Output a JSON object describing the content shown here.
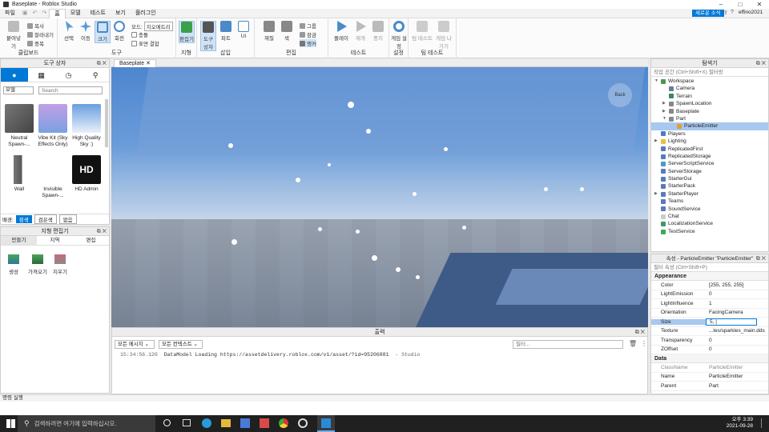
{
  "window": {
    "title": "Baseplate - Roblox Studio"
  },
  "menu": [
    "파일",
    "홈",
    "모델",
    "테스트",
    "보기",
    "플러그인"
  ],
  "user": {
    "share_label": "새로운 소식",
    "username": "effino2021"
  },
  "ribbon": {
    "clipboard": {
      "paste": "붙여넣기",
      "copy": "복사",
      "cut": "잘라내기",
      "duplicate": "중복",
      "label": "클립보드"
    },
    "tools": {
      "select": "선택",
      "move": "이동",
      "scale": "크기",
      "rotate": "회전",
      "mode_label": "모드:",
      "mode_value": "지오메트리",
      "collisions": "충돌",
      "join_surfaces": "표면 결합",
      "label": "도구"
    },
    "terrain": {
      "editor": "편집기",
      "label": "지형"
    },
    "insert": {
      "toolbox": "도구 상자",
      "part": "파트",
      "ui": "UI",
      "label": "삽입"
    },
    "edit": {
      "material": "재질",
      "color": "색",
      "group": "그룹",
      "lock": "잠금",
      "anchor": "앵커",
      "label": "편집"
    },
    "test": {
      "play": "플레이",
      "resume": "재개",
      "stop": "중지",
      "label": "테스트"
    },
    "settings": {
      "game_settings": "게임 설정",
      "label": "설정"
    },
    "team_test": {
      "team_test": "팀 테스트",
      "exit_game": "게임 나가기",
      "label": "팀 테스트"
    }
  },
  "toolbox": {
    "title": "도구 상자",
    "category": "모델",
    "search_placeholder": "Search",
    "items": [
      {
        "label": "Neutral Spawn-...",
        "color": "#555"
      },
      {
        "label": "Vibe Kit (Sky Effects Only)",
        "color": "#b48ad9"
      },
      {
        "label": "High Quality Sky :)",
        "color": "#9ec2ea"
      },
      {
        "label": "Wall",
        "color": "#666"
      },
      {
        "label": "Invisible Spawn-...",
        "color": "#fff"
      },
      {
        "label": "HD Admin",
        "color": "#111"
      }
    ],
    "bg_label": "배경:",
    "bg_options": [
      "흰색",
      "검은색",
      "없음"
    ]
  },
  "terrain_editor": {
    "title": "지형 편집기",
    "tabs": [
      "만들기",
      "지역",
      "편집"
    ],
    "tools": [
      "생성",
      "가져오기",
      "지우기"
    ]
  },
  "viewport": {
    "tab": "Baseplate",
    "back_label": "Back"
  },
  "output": {
    "title": "출력",
    "filter1": "모든 메시지",
    "filter2": "모든 컨텍스트",
    "filter_placeholder": "필터...",
    "log": {
      "time": "15:34:56.120",
      "msg": "DataModel Loading https://assetdelivery.roblox.com/v1/asset/?id=95206881",
      "src": "- Studio"
    }
  },
  "explorer": {
    "title": "탐색기",
    "filter_placeholder": "작업 공간 (Ctrl+Shift+X) 필터링",
    "items": [
      {
        "label": "Workspace",
        "depth": 0,
        "arrow": "open",
        "color": "#4a9a4a"
      },
      {
        "label": "Camera",
        "depth": 1,
        "color": "#6a7a9a"
      },
      {
        "label": "Terrain",
        "depth": 1,
        "color": "#3a8a5a"
      },
      {
        "label": "SpawnLocation",
        "depth": 1,
        "arrow": "closed",
        "color": "#888"
      },
      {
        "label": "Baseplate",
        "depth": 1,
        "arrow": "closed",
        "color": "#888"
      },
      {
        "label": "Part",
        "depth": 1,
        "arrow": "open",
        "color": "#888"
      },
      {
        "label": "ParticleEmitter",
        "depth": 2,
        "color": "#e0a030",
        "selected": true
      },
      {
        "label": "Players",
        "depth": 0,
        "color": "#4a7ac9"
      },
      {
        "label": "Lighting",
        "depth": 0,
        "arrow": "closed",
        "color": "#e8c040"
      },
      {
        "label": "ReplicatedFirst",
        "depth": 0,
        "color": "#5a7ab9"
      },
      {
        "label": "ReplicatedStorage",
        "depth": 0,
        "color": "#5a7ab9"
      },
      {
        "label": "ServerScriptService",
        "depth": 0,
        "color": "#4a9ac9"
      },
      {
        "label": "ServerStorage",
        "depth": 0,
        "color": "#5a7ab9"
      },
      {
        "label": "StarterGui",
        "depth": 0,
        "color": "#5a7ab9"
      },
      {
        "label": "StarterPack",
        "depth": 0,
        "color": "#5a7ab9"
      },
      {
        "label": "StarterPlayer",
        "depth": 0,
        "arrow": "closed",
        "color": "#5a7ab9"
      },
      {
        "label": "Teams",
        "depth": 0,
        "color": "#5a7ab9"
      },
      {
        "label": "SoundService",
        "depth": 0,
        "color": "#5a7ab9"
      },
      {
        "label": "Chat",
        "depth": 0,
        "color": "#ccc"
      },
      {
        "label": "LocalizationService",
        "depth": 0,
        "color": "#3a9a6a"
      },
      {
        "label": "TestService",
        "depth": 0,
        "color": "#3aa95a"
      }
    ]
  },
  "properties": {
    "title": "속성 - ParticleEmitter \"ParticleEmitter\"",
    "filter_placeholder": "필터 속성 (Ctrl+Shift+P)",
    "sections": [
      {
        "name": "Appearance",
        "rows": [
          {
            "k": "Color",
            "v": "[255, 255, 255]"
          },
          {
            "k": "LightEmission",
            "v": "0"
          },
          {
            "k": "LightInfluence",
            "v": "1"
          },
          {
            "k": "Orientation",
            "v": "FacingCamera"
          },
          {
            "k": "Size",
            "v": "5, |",
            "sel": true
          },
          {
            "k": "Texture",
            "v": "...les/sparkles_main.dds"
          },
          {
            "k": "Transparency",
            "v": "0"
          },
          {
            "k": "ZOffset",
            "v": "0"
          }
        ]
      },
      {
        "name": "Data",
        "rows": [
          {
            "k": "ClassName",
            "v": "ParticleEmitter",
            "grey": true
          },
          {
            "k": "Name",
            "v": "ParticleEmitter"
          },
          {
            "k": "Parent",
            "v": "Part"
          }
        ]
      }
    ]
  },
  "command_bar": {
    "label": "명령 실행"
  },
  "taskbar": {
    "search_placeholder": "검색하려면 여기에 입력하십시오.",
    "time": "오후 3:39",
    "date": "2021-09-28"
  },
  "colors": {
    "accent": "#0078d7",
    "selection": "#a8c8ef"
  }
}
